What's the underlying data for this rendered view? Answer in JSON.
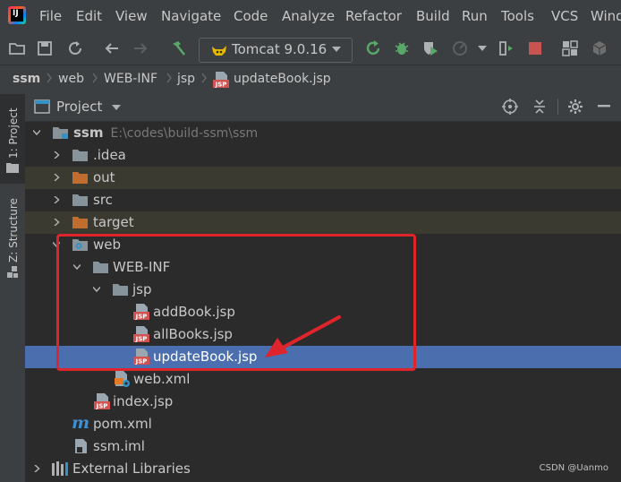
{
  "menu": {
    "items": [
      "File",
      "Edit",
      "View",
      "Navigate",
      "Code",
      "Analyze",
      "Refactor",
      "Build",
      "Run",
      "Tools",
      "VCS",
      "Wind"
    ]
  },
  "toolbar": {
    "run_config": "Tomcat 9.0.16"
  },
  "breadcrumb": [
    "ssm",
    "web",
    "WEB-INF",
    "jsp",
    "updateBook.jsp"
  ],
  "side_tabs": {
    "project": "1: Project",
    "structure": "Z: Structure"
  },
  "panel": {
    "title": "Project"
  },
  "tree": {
    "root": {
      "name": "ssm",
      "path": "E:\\codes\\build-ssm\\ssm"
    },
    "idea": ".idea",
    "out": "out",
    "src": "src",
    "target": "target",
    "web": "web",
    "webinf": "WEB-INF",
    "jsp": "jsp",
    "addbook": "addBook.jsp",
    "allbooks": "allBooks.jsp",
    "updatebook": "updateBook.jsp",
    "webxml": "web.xml",
    "indexjsp": "index.jsp",
    "pomxml": "pom.xml",
    "ssmiml": "ssm.iml",
    "extlibs": "External Libraries"
  },
  "icon_badges": {
    "jsp": "JSP",
    "maven": "m",
    "ide": "IJ"
  },
  "watermark": "CSDN @Uanmo",
  "colors": {
    "selection": "#4b6eaf",
    "annotation": "#e0242b",
    "excluded_folder": "#c26d30",
    "folder": "#87939a"
  }
}
